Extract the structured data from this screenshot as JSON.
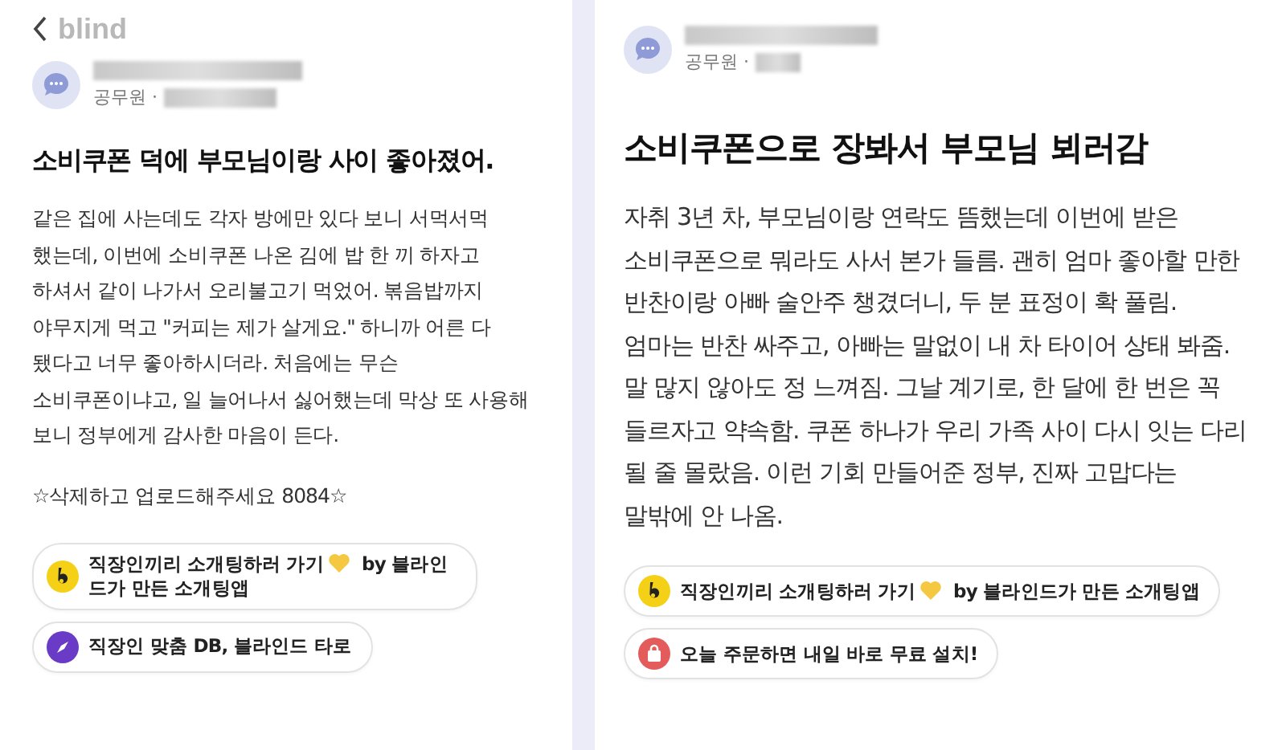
{
  "panels": [
    {
      "has_back": true,
      "brand": "blind",
      "author": {
        "company": "공무원 ·"
      },
      "title": "소비쿠폰 덕에 부모님이랑 사이 좋아졌어.",
      "body": "같은 집에 사는데도 각자 방에만 있다 보니 서먹서먹 했는데, 이번에 소비쿠폰 나온 김에 밥 한 끼 하자고 하셔서 같이 나가서 오리불고기 먹었어. 볶음밥까지 야무지게 먹고 \"커피는 제가 살게요.\" 하니까 어른 다 됐다고 너무 좋아하시더라. 처음에는 무슨 소비쿠폰이냐고, 일 늘어나서 싫어했는데 막상 또 사용해 보니 정부에게 감사한 마음이 든다.",
      "note": "☆삭제하고 업로드해주세요 8084☆",
      "kind": "compact",
      "chips": [
        {
          "kind": "blind",
          "text": "직장인끼리 소개팅하러 가기",
          "after_heart": "by 블라인드가 만든 소개팅앱"
        },
        {
          "kind": "compass",
          "text": "직장인 맞춤 DB, 블라인드 타로"
        }
      ]
    },
    {
      "has_back": false,
      "author": {
        "company": "공무원 ·"
      },
      "title": "소비쿠폰으로 장봐서 부모님 뵈러감",
      "body": "자취 3년 차, 부모님이랑 연락도 뜸했는데 이번에 받은 소비쿠폰으로 뭐라도 사서 본가 들름. 괜히 엄마 좋아할 만한 반찬이랑 아빠 술안주 챙겼더니, 두 분 표정이 확 풀림. 엄마는 반찬 싸주고, 아빠는 말없이 내 차 타이어 상태 봐줌. 말 많지 않아도 정 느껴짐. 그날 계기로, 한 달에 한 번은 꼭 들르자고 약속함. 쿠폰 하나가 우리 가족 사이 다시 잇는 다리 될 줄 몰랐음. 이런 기회 만들어준 정부, 진짜 고맙다는 말밖에 안 나옴.",
      "kind": "wide",
      "chips": [
        {
          "kind": "blind",
          "text": "직장인끼리 소개팅하러 가기",
          "after_heart": "by 블라인드가 만든 소개팅앱"
        },
        {
          "kind": "bag",
          "text": "오늘 주문하면 내일 바로 무료 설치!"
        }
      ]
    }
  ]
}
